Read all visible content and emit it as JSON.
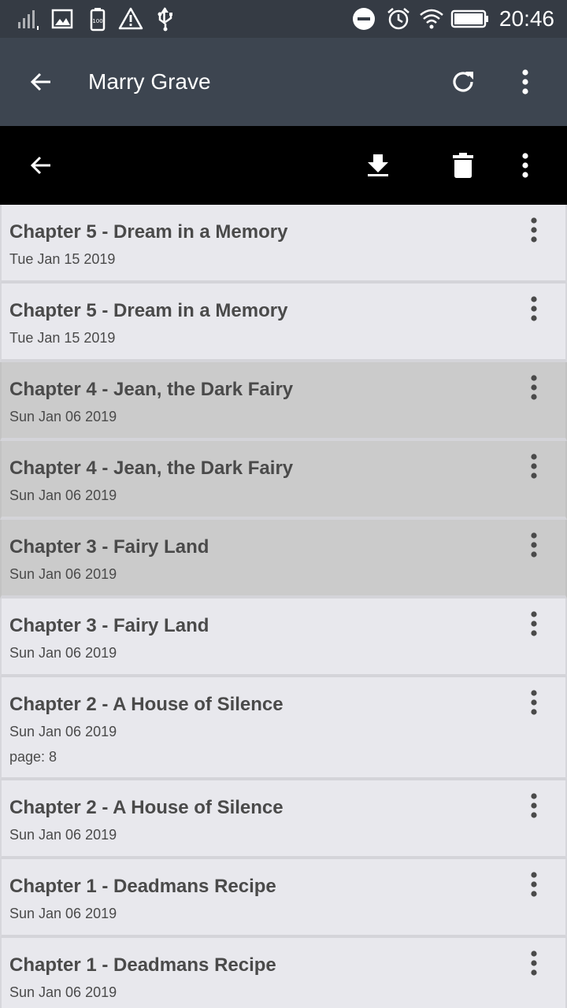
{
  "status_bar": {
    "time": "20:46",
    "icons_left": [
      "signal-icon",
      "image-icon",
      "battery-saver-icon",
      "warning-icon",
      "usb-icon"
    ],
    "icons_right": [
      "do-not-disturb-icon",
      "alarm-icon",
      "wifi-icon",
      "battery-icon"
    ]
  },
  "app_bar": {
    "title": "Marry Grave",
    "back_icon": "arrow-back-icon",
    "refresh_icon": "refresh-icon",
    "menu_icon": "more-vert-icon",
    "background": "#3d4550"
  },
  "action_bar": {
    "back_icon": "arrow-back-icon",
    "download_icon": "download-icon",
    "delete_icon": "delete-icon",
    "menu_icon": "more-vert-icon",
    "background": "#000000"
  },
  "chapters": [
    {
      "title": "Chapter 5 - Dream in a Memory",
      "date": "Tue Jan 15 2019",
      "page": "",
      "selected": false
    },
    {
      "title": "Chapter 5 - Dream in a Memory",
      "date": "Tue Jan 15 2019",
      "page": "",
      "selected": false
    },
    {
      "title": "Chapter 4 - Jean, the Dark Fairy",
      "date": "Sun Jan 06 2019",
      "page": "",
      "selected": true
    },
    {
      "title": "Chapter 4 - Jean, the Dark Fairy",
      "date": "Sun Jan 06 2019",
      "page": "",
      "selected": true
    },
    {
      "title": "Chapter 3 - Fairy Land",
      "date": "Sun Jan 06 2019",
      "page": "",
      "selected": true
    },
    {
      "title": "Chapter 3 - Fairy Land",
      "date": "Sun Jan 06 2019",
      "page": "",
      "selected": false
    },
    {
      "title": "Chapter 2 - A House of Silence",
      "date": "Sun Jan 06 2019",
      "page": "page: 8",
      "selected": false
    },
    {
      "title": "Chapter 2 - A House of Silence",
      "date": "Sun Jan 06 2019",
      "page": "",
      "selected": false
    },
    {
      "title": "Chapter 1 - Deadmans Recipe",
      "date": "Sun Jan 06 2019",
      "page": "",
      "selected": false
    },
    {
      "title": "Chapter 1 - Deadmans Recipe",
      "date": "Sun Jan 06 2019",
      "page": "",
      "selected": false
    }
  ],
  "colors": {
    "status_bar": "#353b44",
    "item_background": "#e8e8ed",
    "item_selected_background": "#cbcbcb",
    "text": "#4a4a4a"
  }
}
